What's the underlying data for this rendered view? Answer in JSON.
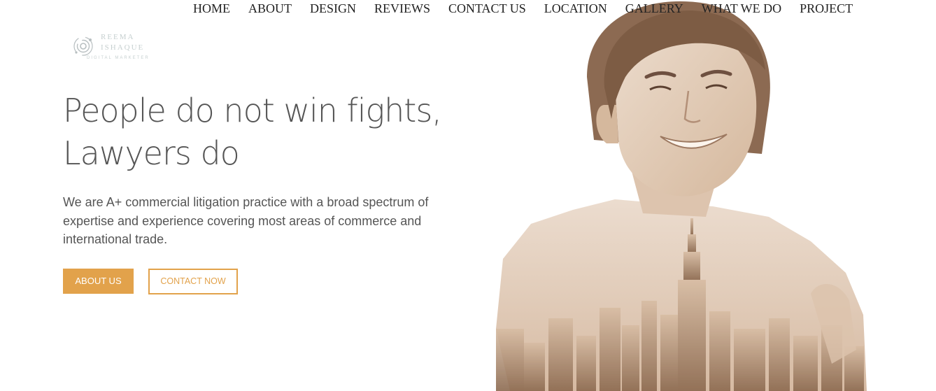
{
  "nav": {
    "items": [
      "HOME",
      "ABOUT",
      "DESIGN",
      "REVIEWS",
      "CONTACT US",
      "LOCATION",
      "GALLERY",
      "WHAT WE DO",
      "PROJECT"
    ]
  },
  "logo": {
    "line1": "REEMA",
    "line2": "ISHAQUE",
    "tagline": "DIGITAL MARKETER"
  },
  "hero": {
    "headline_line1": "People do not win fights,",
    "headline_line2": "Lawyers do",
    "description": "We are A+ commercial litigation practice with a broad spectrum of expertise and experience covering most areas of commerce and international trade.",
    "about_button": "ABOUT US",
    "contact_button": "CONTACT NOW"
  },
  "colors": {
    "accent": "#e2a24b",
    "text": "#555555",
    "nav_text": "#222222",
    "sepia": "#c7a588"
  }
}
